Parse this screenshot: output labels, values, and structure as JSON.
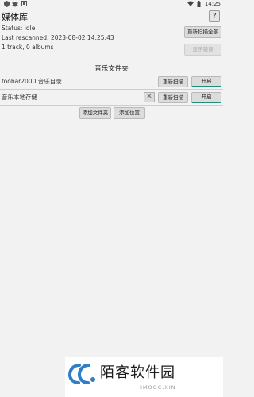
{
  "status_bar": {
    "time": "14:25",
    "left_icons": [
      "shield-icon",
      "bug-icon",
      "notification-icon"
    ],
    "right_icons": [
      "wifi-icon",
      "battery-icon"
    ]
  },
  "header": {
    "title": "媒体库",
    "help_label": "?"
  },
  "library": {
    "status": "Status: idle",
    "last_rescanned": "Last rescanned: 2023-08-02 14:25:43",
    "counts": "1 track, 0 albums",
    "rescan_all_label": "重新扫描全部",
    "show_errors_label": "显示错误"
  },
  "folders": {
    "section_title": "音乐文件夹",
    "items": [
      {
        "label": "foobar2000 音乐目录",
        "rescan_label": "重新扫描",
        "toggle_label": "开启"
      },
      {
        "label": "音乐本地存储",
        "remove_label": "✕",
        "rescan_label": "重新扫描",
        "toggle_label": "开启"
      }
    ],
    "add_folder_label": "添加文件夹",
    "add_location_label": "添加位置"
  },
  "watermark": {
    "text": "陌客软件园",
    "sub": "IMOOC.XIN"
  }
}
